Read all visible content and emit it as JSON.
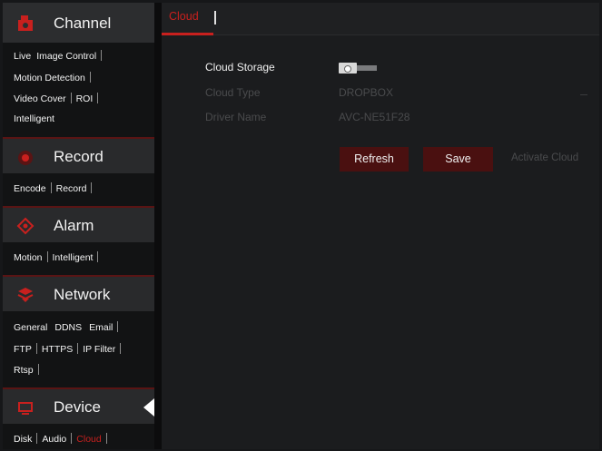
{
  "sidebar": {
    "sections": [
      {
        "title": "Channel",
        "icon": "channel-camera-icon",
        "subitems": [
          [
            "Live",
            "Image Control"
          ],
          [
            "Motion Detection"
          ],
          [
            "Video Cover",
            "ROI"
          ],
          [
            "Intelligent"
          ]
        ]
      },
      {
        "title": "Record",
        "icon": "record-icon",
        "subitems": [
          [
            "Encode",
            "Record"
          ]
        ]
      },
      {
        "title": "Alarm",
        "icon": "alarm-icon",
        "subitems": [
          [
            "Motion",
            "Intelligent"
          ]
        ]
      },
      {
        "title": "Network",
        "icon": "network-icon",
        "subitems": [
          [
            "General",
            "DDNS",
            "Email"
          ],
          [
            "FTP",
            "HTTPS",
            "IP Filter"
          ],
          [
            "Rtsp"
          ]
        ]
      },
      {
        "title": "Device",
        "icon": "device-icon",
        "subitems": [
          [
            "Disk",
            "Audio",
            "Cloud"
          ]
        ],
        "active_subitem": "Cloud"
      }
    ]
  },
  "main": {
    "tab": "Cloud",
    "rows": {
      "cloud_storage_label": "Cloud Storage",
      "cloud_type_label": "Cloud Type",
      "cloud_type_value": "DROPBOX",
      "driver_name_label": "Driver Name",
      "driver_name_value": "AVC-NE51F28"
    },
    "buttons": {
      "refresh": "Refresh",
      "save": "Save",
      "activate": "Activate Cloud"
    }
  },
  "colors": {
    "accent": "#c8201e",
    "button_bg": "#4a1010",
    "sidebar_header": "#2c2d2f",
    "background": "#161719"
  }
}
